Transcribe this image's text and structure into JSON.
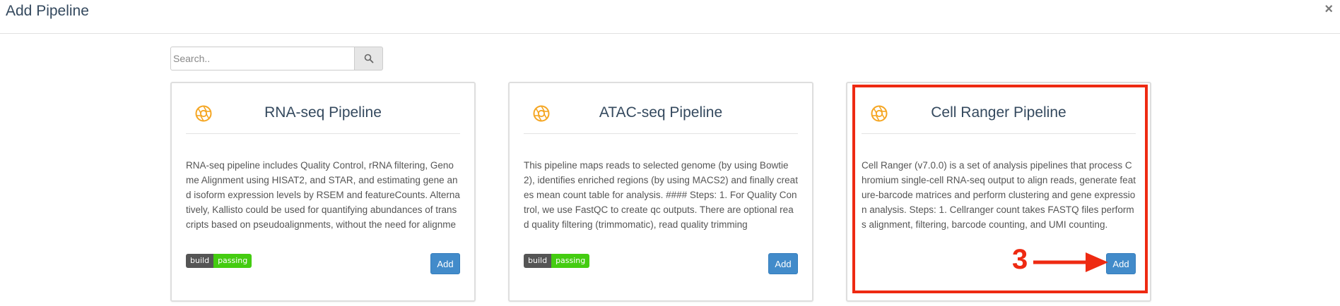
{
  "modal": {
    "title": "Add Pipeline",
    "close_label": "×"
  },
  "search": {
    "placeholder": "Search..",
    "value": ""
  },
  "colors": {
    "title": "#34495e",
    "accent_icon": "#f5a623",
    "add_button": "#428bca",
    "badge_pass": "#44cc11",
    "annotation": "#ee2a12"
  },
  "cards": [
    {
      "title": "RNA-seq Pipeline",
      "icon": "aperture-icon",
      "description": "RNA-seq pipeline includes Quality Control, rRNA filtering, Genome Alignment using HISAT2, and STAR, and estimating gene and isoform expression levels by RSEM and featureCounts. Alternatively, Kallisto could be used for quantifying abundances of transcripts based on pseudoalignments, without the need for alignment.",
      "badge_left": "build",
      "badge_right": "passing",
      "add_label": "Add"
    },
    {
      "title": "ATAC-seq Pipeline",
      "icon": "aperture-icon",
      "description": "This pipeline maps reads to selected genome (by using Bowtie2), identifies enriched regions (by using MACS2) and finally creates mean count table for analysis. #### Steps: 1. For Quality Control, we use FastQC to create qc outputs. There are optional read quality filtering (trimmomatic), read quality trimming",
      "badge_left": "build",
      "badge_right": "passing",
      "add_label": "Add"
    },
    {
      "title": "Cell Ranger Pipeline",
      "icon": "aperture-icon",
      "description": "Cell Ranger (v7.0.0) is a set of analysis pipelines that process Chromium single-cell RNA-seq output to align reads, generate feature-barcode matrices and perform clustering and gene expression analysis. Steps: 1. Cellranger count takes FASTQ files performs alignment, filtering, barcode counting, and UMI counting.",
      "add_label": "Add"
    }
  ],
  "annotation": {
    "step_number": "3"
  }
}
